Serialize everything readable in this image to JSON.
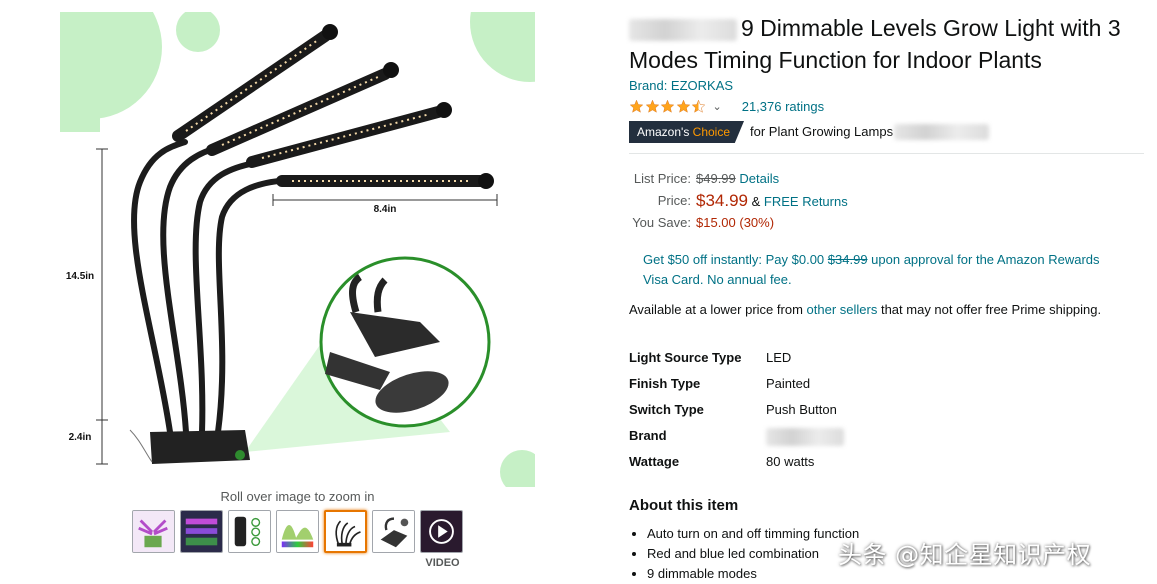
{
  "product": {
    "title": "9 Dimmable Levels Grow Light with 3 Modes Timing Function for Indoor Plants",
    "brand_link": "Brand: EZORKAS",
    "rating_value": 4.5,
    "rating_caret": "⌄",
    "ratings_count": "21,376 ratings",
    "choice_badge_prefix": "Amazon's",
    "choice_badge_accent": "Choice",
    "choice_for": "for Plant Growing Lamps"
  },
  "pricing": {
    "list_label": "List Price:",
    "list_value": "$49.99",
    "details_link": "Details",
    "price_label": "Price:",
    "price_value": "$34.99",
    "returns_amp": "&",
    "returns_link": "FREE Returns",
    "save_label": "You Save:",
    "save_value": "$15.00 (30%)"
  },
  "promo": {
    "part1": "Get $50 off instantly: Pay $0.00",
    "strike": "$34.99",
    "part2": "upon approval for the Amazon Rewards Visa Card. No annual fee."
  },
  "lower_price": {
    "part1": "Available at a lower price from",
    "link": "other sellers",
    "part2": "that may not offer free Prime shipping."
  },
  "specs": [
    {
      "key": "Light Source Type",
      "value": "LED"
    },
    {
      "key": "Finish Type",
      "value": "Painted"
    },
    {
      "key": "Switch Type",
      "value": "Push Button"
    },
    {
      "key": "Brand",
      "value": ""
    },
    {
      "key": "Wattage",
      "value": "80 watts"
    }
  ],
  "about": {
    "title": "About this item",
    "items": [
      "Auto turn on and off timming function",
      "Red and blue led combination",
      "9 dimmable modes"
    ]
  },
  "gallery": {
    "zoom_hint": "Roll over image to zoom in",
    "dim_width": "8.4in",
    "dim_height": "14.5in",
    "dim_clip": "2.4in",
    "video_label": "VIDEO",
    "thumb_icons": [
      "grow-light-photo-icon",
      "led-panel-icon",
      "timer-controller-icon",
      "light-spectrum-icon",
      "lamp-dimensions-icon",
      "clip-mount-icon",
      "video-play-icon"
    ]
  },
  "colors": {
    "link": "#007185",
    "price": "#b12704",
    "star": "#ffa41c",
    "badge_bg": "#232f3e",
    "badge_accent": "#ff9900",
    "accent_green": "#c8f0c8",
    "thumb_active": "#e77600"
  },
  "watermark": "头条 @知企星知识产权"
}
